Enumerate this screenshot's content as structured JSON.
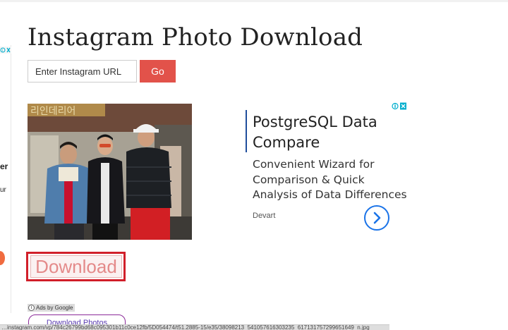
{
  "page": {
    "title": "Instagram Photo Download"
  },
  "search": {
    "placeholder": "Enter Instagram URL",
    "go_label": "Go"
  },
  "ad": {
    "title": "PostgreSQL Data Compare",
    "description": "Convenient Wizard for Comparison & Quick Analysis of Data Differences",
    "advertiser": "Devart",
    "arrow_icon": "chevron-right-icon",
    "accent_color": "#1a73e8"
  },
  "left_ad": {
    "fragment_1": "er",
    "fragment_2": "ur"
  },
  "download": {
    "label": "Download",
    "frame_color": "#d11f2a"
  },
  "ads_by_google": "Ads by Google",
  "download_photos_label": "Download Photos",
  "status_bar": {
    "url": "…instagram.com/vp/784c26799bd68c095301b11c0ce12fb/5D054474/t51.2885-15/e35/38098213_541057616303235_617131757299651649_n.jpg"
  },
  "colors": {
    "go_button": "#e2524a",
    "download_text": "#e48a8a"
  }
}
